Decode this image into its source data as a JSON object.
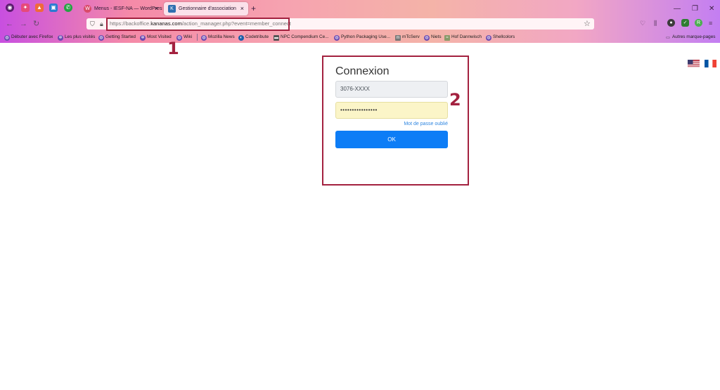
{
  "browser": {
    "tabs": [
      {
        "label": "Menus - IESF-NA — WordPress",
        "active": false,
        "icon": "wordpress-icon"
      },
      {
        "label": "Gestionnaire d'association",
        "active": true,
        "icon": "kananas-k-icon"
      }
    ],
    "new_tab_symbol": "+",
    "tab_close_symbol": "×",
    "url_scheme": "https://backoffice.",
    "url_domain": "kananas.com",
    "url_path": "/action_manager.php?event=member_connect",
    "bookmarks": [
      {
        "label": "Débuter avec Firefox",
        "icon": "globe-icon"
      },
      {
        "label": "Les plus visités",
        "icon": "gear-icon"
      },
      {
        "label": "Getting Started",
        "icon": "globe-icon"
      },
      {
        "label": "Most Visited",
        "icon": "gear-icon"
      },
      {
        "label": "Wiki",
        "icon": "globe-icon"
      },
      {
        "label": "Mozilla News",
        "icon": "globe-icon"
      },
      {
        "label": "Codetribute",
        "icon": "codetribute-icon"
      },
      {
        "label": "NPC Compendium Ce...",
        "icon": "car-icon"
      },
      {
        "label": "Python Packaging Use...",
        "icon": "globe-icon"
      },
      {
        "label": "mTcServ",
        "icon": "mtc-icon"
      },
      {
        "label": "Niets",
        "icon": "globe-icon"
      },
      {
        "label": "Hof Dannwisch",
        "icon": "hof-icon"
      },
      {
        "label": "Shellcolors",
        "icon": "globe-icon"
      }
    ],
    "other_bookmarks": "Autres marque-pages"
  },
  "login": {
    "title": "Connexion",
    "username_value": "3076-XXXX",
    "password_value": "••••••••••••••••",
    "forgot_link": "Mot de passe oublié",
    "submit_label": "OK"
  },
  "annotations": {
    "marker_1": "1",
    "marker_2": "2"
  },
  "languages": [
    {
      "code": "en",
      "flag": "us-flag-icon"
    },
    {
      "code": "fr",
      "flag": "fr-flag-icon"
    }
  ],
  "colors": {
    "annotation": "#a3213f",
    "primary_button": "#0d7df6",
    "link": "#2f86e0",
    "autofill": "#fbf5c8"
  }
}
